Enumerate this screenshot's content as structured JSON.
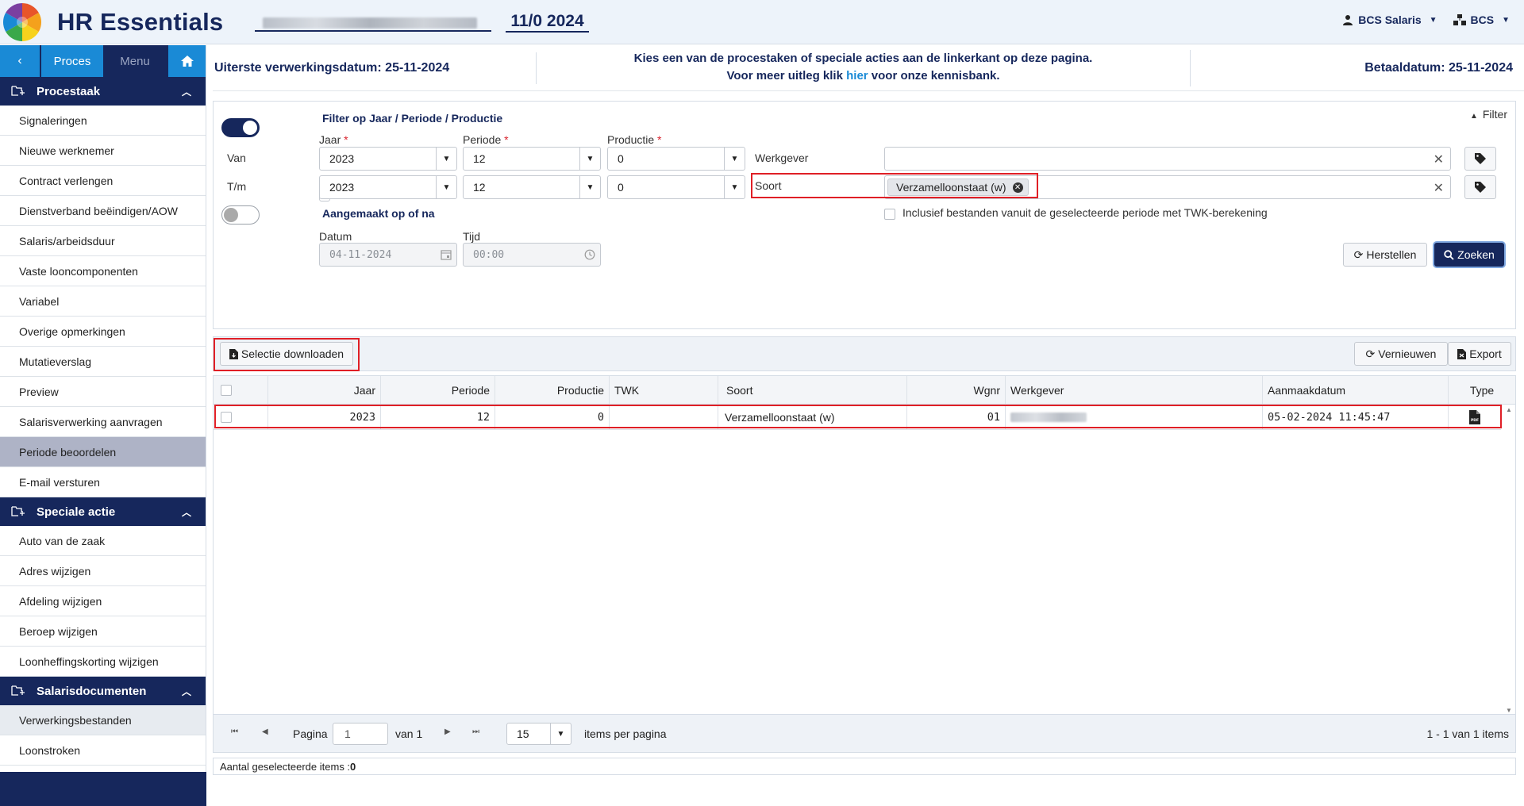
{
  "header": {
    "app_title": "HR Essentials",
    "period": "11/0 2024",
    "user_menu": "BCS Salaris",
    "org_menu": "BCS"
  },
  "sidebar": {
    "tabs": {
      "proces": "Proces",
      "menu": "Menu"
    },
    "sections": [
      {
        "title": "Procestaak",
        "items": [
          "Signaleringen",
          "Nieuwe werknemer",
          "Contract verlengen",
          "Dienstverband beëindigen/AOW",
          "Salaris/arbeidsduur",
          "Vaste looncomponenten",
          "Variabel",
          "Overige opmerkingen",
          "Mutatieverslag",
          "Preview",
          "Salarisverwerking aanvragen",
          "Periode beoordelen",
          "E-mail versturen"
        ]
      },
      {
        "title": "Speciale actie",
        "items": [
          "Auto van de zaak",
          "Adres wijzigen",
          "Afdeling wijzigen",
          "Beroep wijzigen",
          "Loonheffingskorting wijzigen"
        ]
      },
      {
        "title": "Salarisdocumenten",
        "items": [
          "Verwerkingsbestanden",
          "Loonstroken"
        ]
      }
    ]
  },
  "infobar": {
    "left": "Uiterste verwerkingsdatum: 25-11-2024",
    "mid_line1": "Kies een van de procestaken of speciale acties aan de linkerkant op deze pagina.",
    "mid_line2_pre": "Voor meer uitleg klik ",
    "mid_link": "hier",
    "mid_line2_post": " voor onze kennisbank.",
    "right": "Betaaldatum: 25-11-2024"
  },
  "filter": {
    "panel_label": "Filter",
    "title_period": "Filter op Jaar / Periode / Productie",
    "col_jaar": "Jaar",
    "col_periode": "Periode",
    "col_productie": "Productie",
    "req_mark": "*",
    "row_van": "Van",
    "row_tm": "T/m",
    "van": {
      "jaar": "2023",
      "periode": "12",
      "productie": "0"
    },
    "tm": {
      "jaar": "2023",
      "periode": "12",
      "productie": "0"
    },
    "werkgever_label": "Werkgever",
    "soort_label": "Soort",
    "soort_chip": "Verzamelloonstaat (w)",
    "title_created": "Aangemaakt op of na",
    "twk_label": "Inclusief bestanden vanuit de geselecteerde periode met TWK-berekening",
    "datum_label": "Datum",
    "tijd_label": "Tijd",
    "datum_value": "04-11-2024",
    "tijd_value": "00:00",
    "btn_reset": "Herstellen",
    "btn_search": "Zoeken"
  },
  "grid": {
    "btn_download": "Selectie downloaden",
    "btn_refresh": "Vernieuwen",
    "btn_export": "Export",
    "columns": [
      "Jaar",
      "Periode",
      "Productie",
      "TWK",
      "Soort",
      "Wgnr",
      "Werkgever",
      "Aanmaakdatum",
      "Type"
    ],
    "rows": [
      {
        "jaar": "2023",
        "periode": "12",
        "productie": "0",
        "twk": "",
        "soort": "Verzamelloonstaat (w)",
        "wgnr": "01",
        "aanmaakdatum": "05-02-2024 11:45:47"
      }
    ],
    "pager": {
      "pagina_label": "Pagina",
      "page": "1",
      "van_label": "van 1",
      "page_size": "15",
      "per_page_label": "items per pagina",
      "summary": "1 - 1 van 1 items"
    },
    "status_label": "Aantal geselecteerde items : ",
    "status_count": "0"
  },
  "colors": {
    "navy": "#16275c",
    "blue": "#1a8ad6",
    "highlight": "#e01f26"
  }
}
